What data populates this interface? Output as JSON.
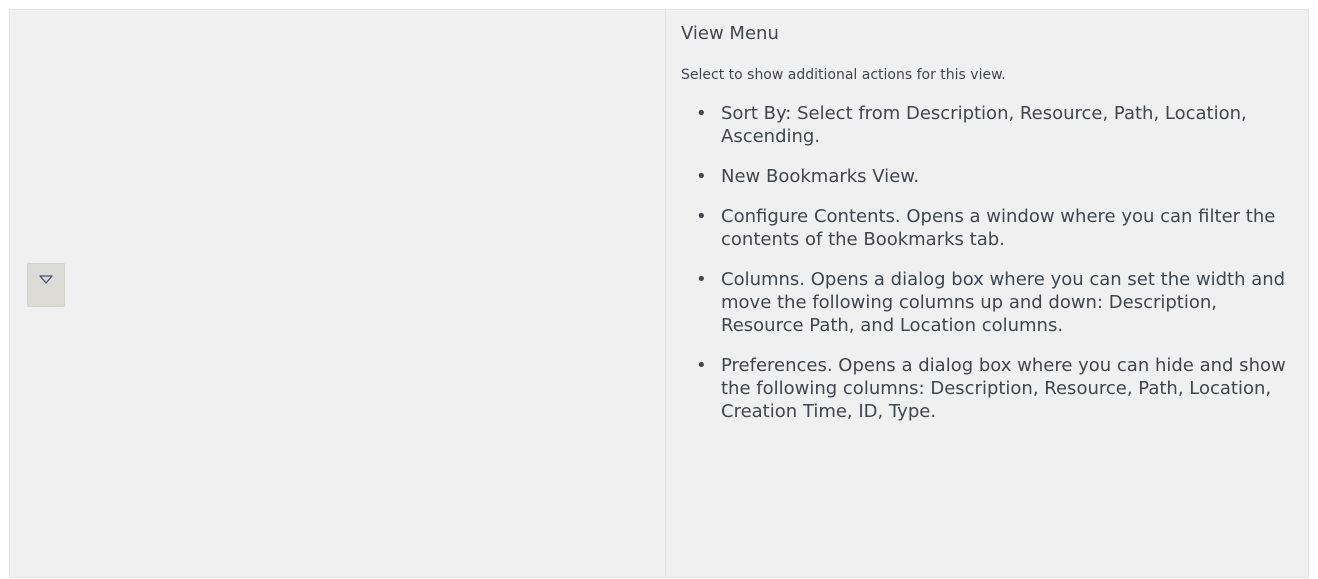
{
  "row": {
    "icon": {
      "name": "view-menu-triangle-icon",
      "fill": "#dcdbd5",
      "stroke": "#4a4f73"
    },
    "title": "View Menu",
    "intro": "Select to show additional actions for this view.",
    "items": [
      {
        "text": "Sort By: Select from Description, Resource, Path, Location, Ascending."
      },
      {
        "text": "New Bookmarks View."
      },
      {
        "text": "Configure Contents. Opens a window where you can filter the contents of the Bookmarks tab."
      },
      {
        "text": "Columns. Opens a dialog box where you can set the width and move the following columns up and down: Description, Resource Path, and Location columns."
      },
      {
        "text": "Preferences. Opens a dialog box where you can hide and show the following columns: Description, Resource, Path, Location, Creation Time, ID, Type."
      }
    ]
  }
}
